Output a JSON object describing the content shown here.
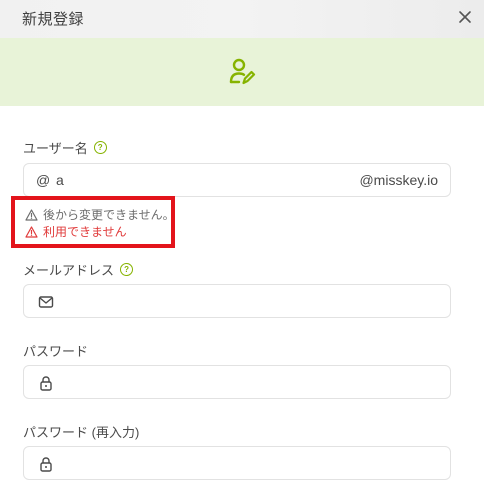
{
  "dialog": {
    "title": "新規登録"
  },
  "username": {
    "label": "ユーザー名",
    "prefix": "@",
    "value": "a",
    "suffix": "@misskey.io",
    "hint_cannot_change": "後から変更できません。",
    "error_unavailable": "利用できません"
  },
  "email": {
    "label": "メールアドレス",
    "value": ""
  },
  "password": {
    "label": "パスワード",
    "value": ""
  },
  "password_retype": {
    "label": "パスワード (再入力)",
    "value": ""
  },
  "help_glyph": "?",
  "colors": {
    "accent": "#86b300",
    "banner": "#e8f3d8",
    "error": "#e03a3a",
    "highlight": "#e3141b"
  },
  "icons": {
    "close": "close-icon",
    "banner": "user-edit-icon",
    "help": "help-circle-icon",
    "warning": "warning-icon",
    "mail": "mail-icon",
    "lock": "lock-icon"
  }
}
